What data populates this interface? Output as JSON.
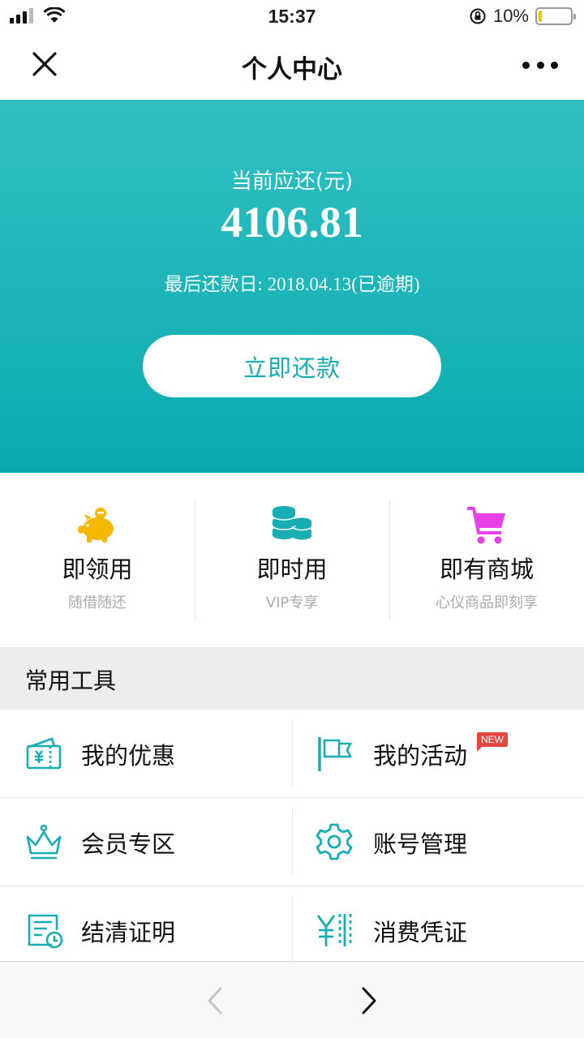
{
  "status_bar": {
    "time": "15:37",
    "battery_percent": "10%",
    "battery_level": 0.1,
    "icons": [
      "signal-icon",
      "wifi-icon",
      "orientation-lock-icon",
      "battery-icon"
    ]
  },
  "nav": {
    "title": "个人中心",
    "close_icon": "close-icon",
    "more_icon": "more-icon"
  },
  "hero": {
    "label": "当前应还(元)",
    "amount": "4106.81",
    "due_text": "最后还款日: 2018.04.13(已逾期)",
    "button_label": "立即还款",
    "gradient": [
      "#31c0c2",
      "#0aabb0"
    ]
  },
  "quick_entries": [
    {
      "title": "即领用",
      "subtitle": "随借随还",
      "icon": "piggy-bank-icon",
      "color": "#f5b800"
    },
    {
      "title": "即时用",
      "subtitle": "VIP专享",
      "icon": "coins-icon",
      "color": "#16aeb2"
    },
    {
      "title": "即有商城",
      "subtitle": "心仪商品即刻享",
      "icon": "shopping-cart-icon",
      "color": "#e840e8"
    }
  ],
  "tools_section": {
    "title": "常用工具",
    "items": [
      {
        "label": "我的优惠",
        "icon": "coupon-icon"
      },
      {
        "label": "我的活动",
        "icon": "flag-icon",
        "badge": "NEW"
      },
      {
        "label": "会员专区",
        "icon": "crown-icon"
      },
      {
        "label": "账号管理",
        "icon": "settings-gear-icon"
      },
      {
        "label": "结清证明",
        "icon": "certificate-icon"
      },
      {
        "label": "消费凭证",
        "icon": "receipt-icon"
      }
    ],
    "accent": "#16aeb2",
    "badge_color": "#e8473d"
  },
  "browser_bar": {
    "back_icon": "back-arrow-icon",
    "forward_icon": "forward-arrow-icon"
  }
}
